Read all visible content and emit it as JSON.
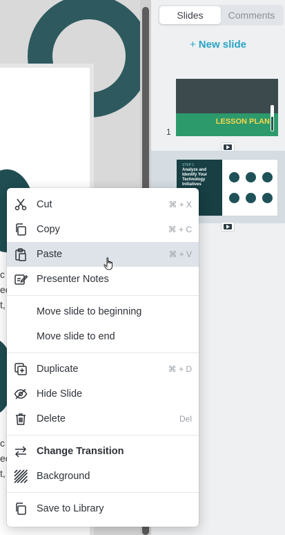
{
  "panel": {
    "tabs": [
      {
        "label": "Slides",
        "active": true
      },
      {
        "label": "Comments",
        "active": false
      }
    ],
    "new_slide_label": "New slide",
    "slides": [
      {
        "number": "1",
        "title": "LESSON PLAN"
      },
      {
        "number": "",
        "step": "STEP 1",
        "title": "Analyze and Identify Your Technology Initiatives"
      }
    ]
  },
  "canvas": {
    "fragments": [
      "c",
      "ec",
      "t,",
      "c",
      "ec",
      "t,"
    ]
  },
  "context_menu": {
    "items": [
      {
        "icon": "scissors-icon",
        "label": "Cut",
        "shortcut": "⌘ + X"
      },
      {
        "icon": "copy-icon",
        "label": "Copy",
        "shortcut": "⌘ + C"
      },
      {
        "icon": "paste-icon",
        "label": "Paste",
        "shortcut": "⌘ + V",
        "hover": true
      },
      {
        "icon": "presenter-notes-icon",
        "label": "Presenter Notes",
        "shortcut": ""
      },
      {
        "label": "Move slide to beginning",
        "shortcut": ""
      },
      {
        "label": "Move slide to end",
        "shortcut": ""
      },
      {
        "icon": "duplicate-icon",
        "label": "Duplicate",
        "shortcut": "⌘ + D"
      },
      {
        "icon": "eye-slash-icon",
        "label": "Hide Slide",
        "shortcut": ""
      },
      {
        "icon": "trash-icon",
        "label": "Delete",
        "shortcut": "Del"
      },
      {
        "icon": "transition-arrows-icon",
        "label": "Change Transition",
        "shortcut": "",
        "bold": true
      },
      {
        "icon": "background-stripes-icon",
        "label": "Background",
        "shortcut": ""
      },
      {
        "icon": "library-icon",
        "label": "Save to Library",
        "shortcut": ""
      }
    ]
  },
  "colors": {
    "accent": "#2aa3c5",
    "teal_dark": "#1f4d52",
    "menu_hover": "#dde3e8"
  }
}
